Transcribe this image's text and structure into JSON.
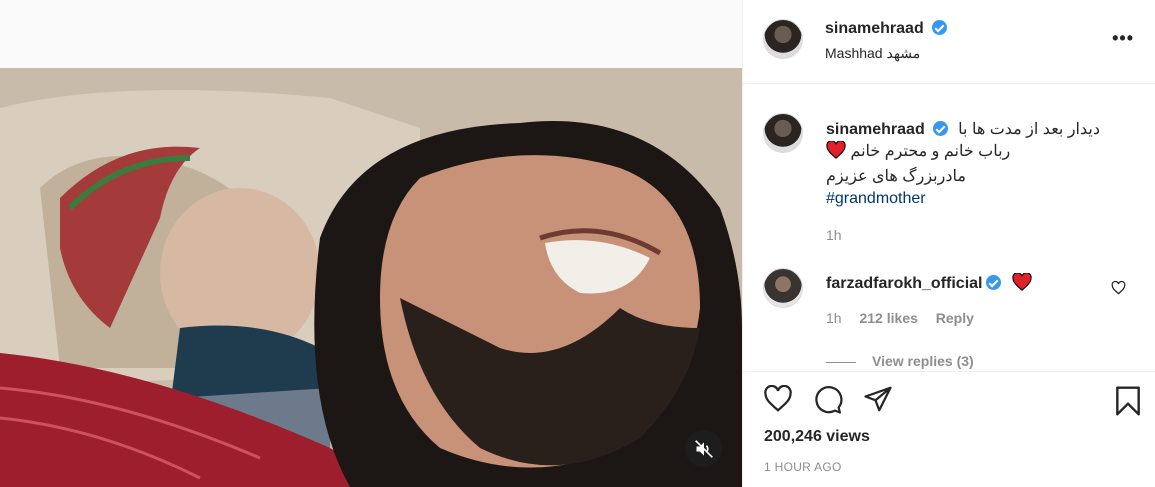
{
  "post": {
    "username": "sinamehraad",
    "location": "Mashhad مشهد",
    "more_icon": "more-icon",
    "caption_lines": [
      "دیدار بعد از مدت ها با",
      "رباب خانم و محترم خانم",
      "مادربزرگ های عزیزم"
    ],
    "hashtag": "#grandmother",
    "caption_time": "1h"
  },
  "comment": {
    "username": "farzadfarokh_official",
    "time": "1h",
    "likes": "212 likes",
    "reply_label": "Reply",
    "view_replies": "View replies (3)"
  },
  "stats": {
    "views": "200,246 views",
    "timeago": "1 HOUR AGO"
  },
  "colors": {
    "verified": "#3897f0",
    "heart": "#ed4956",
    "link": "#00376b",
    "secondary_text": "#8e8e8e"
  }
}
